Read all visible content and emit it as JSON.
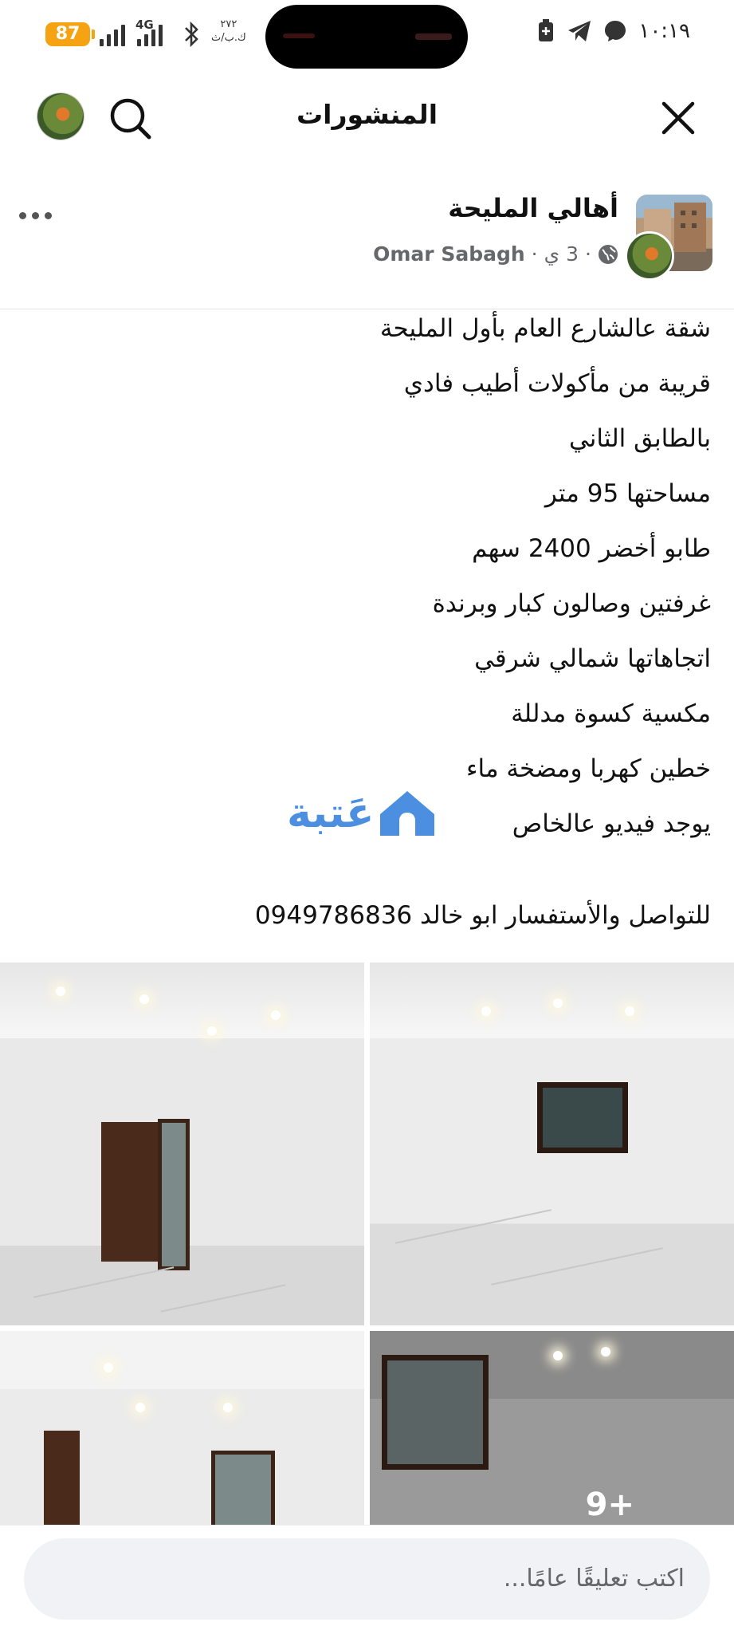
{
  "status_bar": {
    "battery": "87",
    "network": "4G",
    "carrier_rate": "٢٧٢\nك.ب/ث",
    "time": "١٠:١٩"
  },
  "header": {
    "title": "المنشورات"
  },
  "post": {
    "group_name": "أهالي المليحة",
    "time_ago": "3 ي",
    "author": "Omar Sabagh",
    "lines": [
      "شقة عالشارع العام بأول المليحة",
      "قريبة من مأكولات أطيب فادي",
      "بالطابق الثاني",
      "مساحتها 95 متر",
      "طابو أخضر 2400 سهم",
      "غرفتين وصالون كبار وبرندة",
      "اتجاهاتها شمالي شرقي",
      "مكسية كسوة مدللة",
      "خطين كهربا ومضخة ماء",
      "يوجد فيديو عالخاص"
    ],
    "contact": "للتواصل والأستفسار ابو خالد 0949786836",
    "more_photos": "9+"
  },
  "watermark": "عَتبة",
  "comment": {
    "placeholder": "اكتب تعليقًا عامًا..."
  }
}
